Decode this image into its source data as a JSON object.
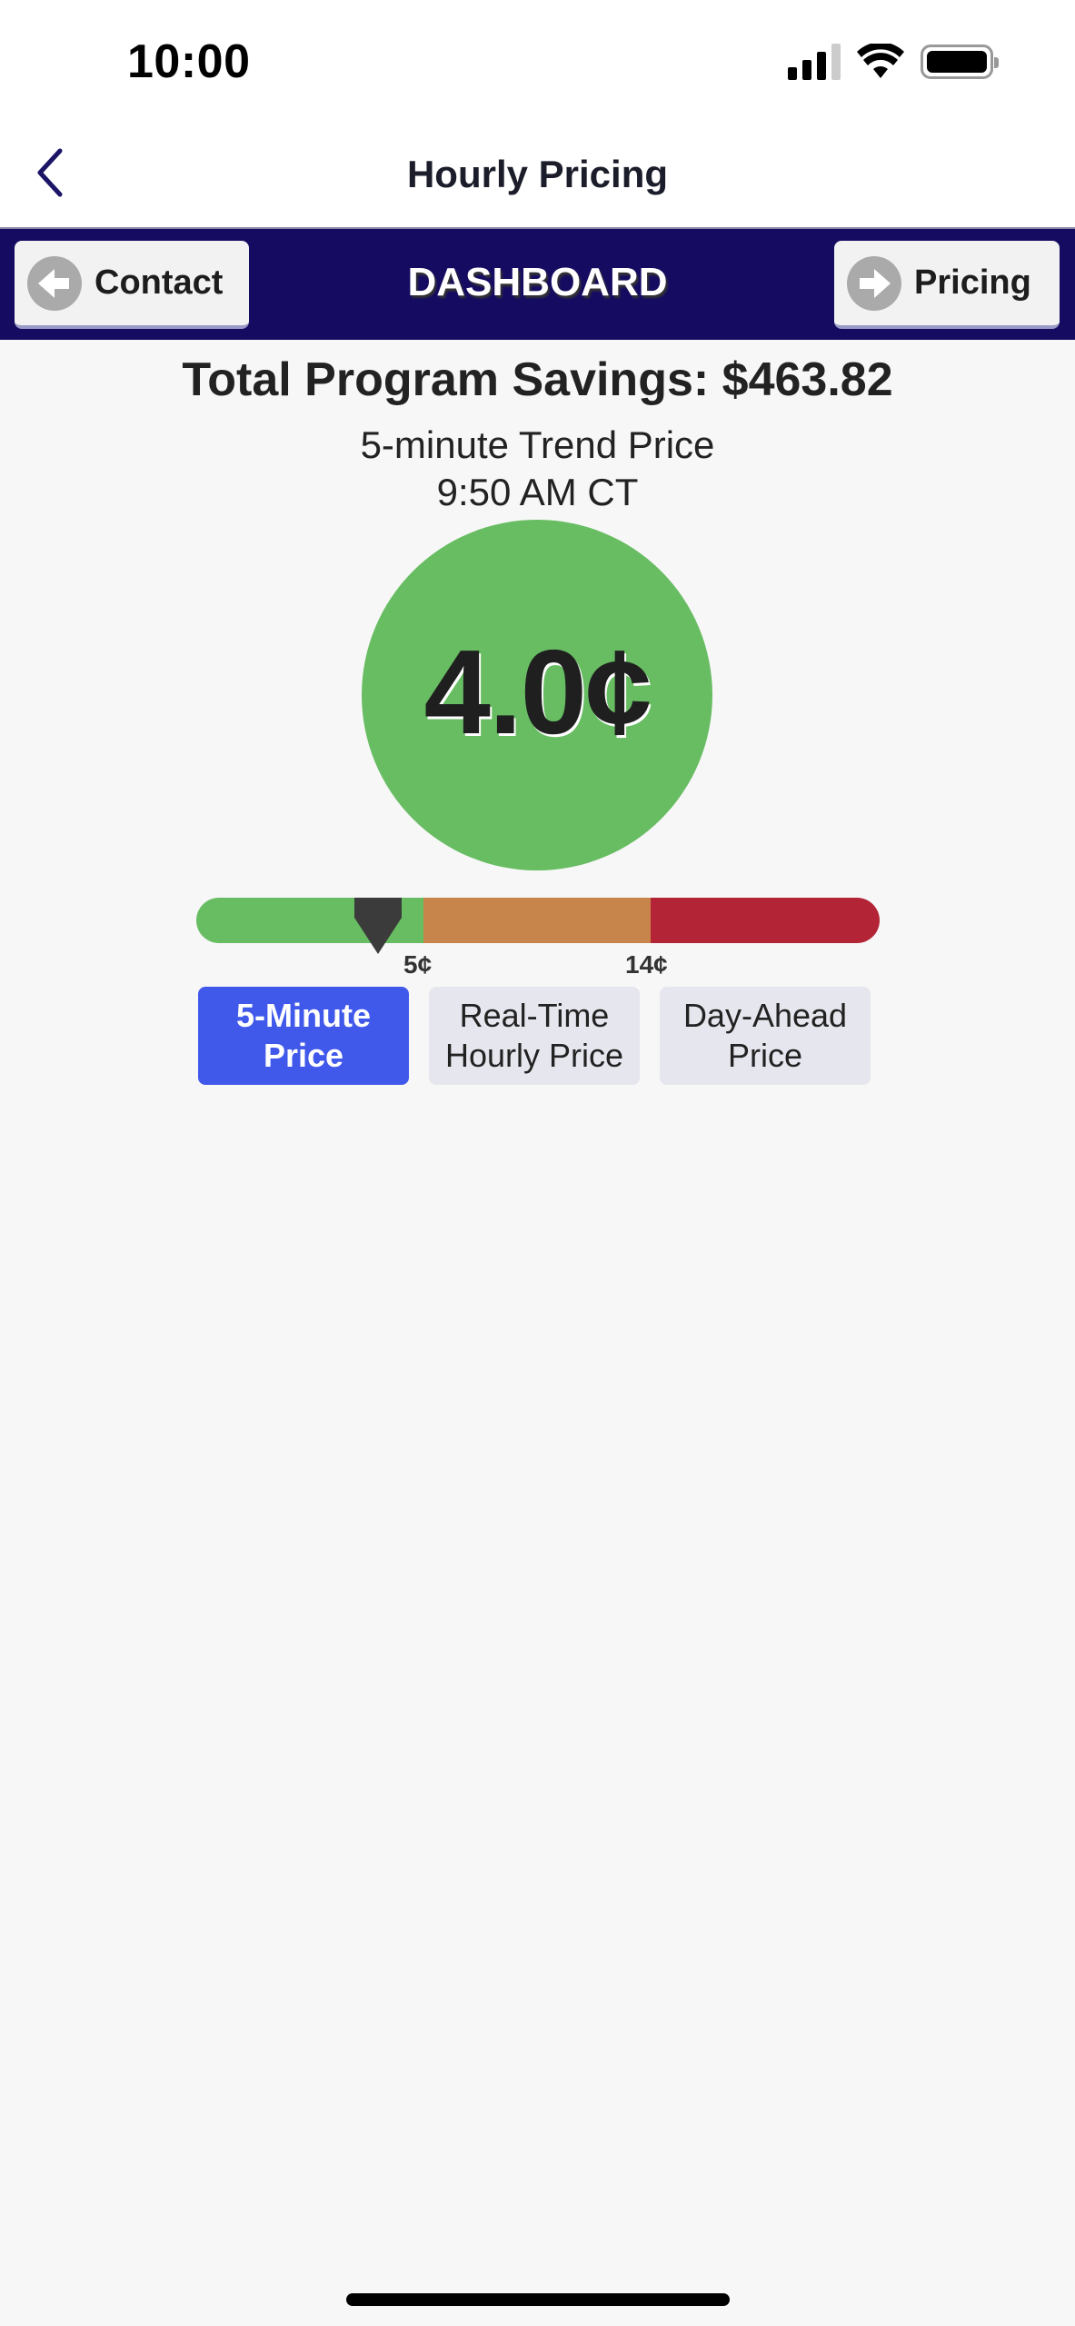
{
  "status_bar": {
    "time": "10:00",
    "icons": [
      "cellular-signal-icon",
      "wifi-icon",
      "battery-icon"
    ]
  },
  "nav": {
    "back_icon": "chevron-left-icon",
    "title": "Hourly Pricing"
  },
  "dashboard_bar": {
    "title": "DASHBOARD",
    "left_button": {
      "label": "Contact",
      "icon": "arrow-left-circle-icon"
    },
    "right_button": {
      "label": "Pricing",
      "icon": "arrow-right-circle-icon"
    }
  },
  "main": {
    "savings": "Total Program Savings: $463.82",
    "trend_label": "5-minute Trend Price",
    "trend_time": "9:50 AM CT",
    "price": "4.0¢",
    "price_value_cents": 4.0,
    "gauge": {
      "thresholds": [
        {
          "label": "5¢",
          "value": 5
        },
        {
          "label": "14¢",
          "value": 14
        }
      ],
      "zones": [
        {
          "name": "low",
          "color": "#68bd63"
        },
        {
          "name": "medium",
          "color": "#c8854b"
        },
        {
          "name": "high",
          "color": "#b32536"
        }
      ],
      "current_cents": 4.0
    },
    "tabs": [
      {
        "label": "5-Minute Price",
        "line1": "5-Minute",
        "line2": "Price",
        "active": true
      },
      {
        "label": "Real-Time Hourly Price",
        "line1": "Real-Time",
        "line2": "Hourly Price",
        "active": false
      },
      {
        "label": "Day-Ahead Price",
        "line1": "Day-Ahead",
        "line2": "Price",
        "active": false
      }
    ]
  },
  "colors": {
    "dashboard_bar": "#150c62",
    "active_tab": "#4159eb",
    "price_circle": "#68bd63"
  }
}
